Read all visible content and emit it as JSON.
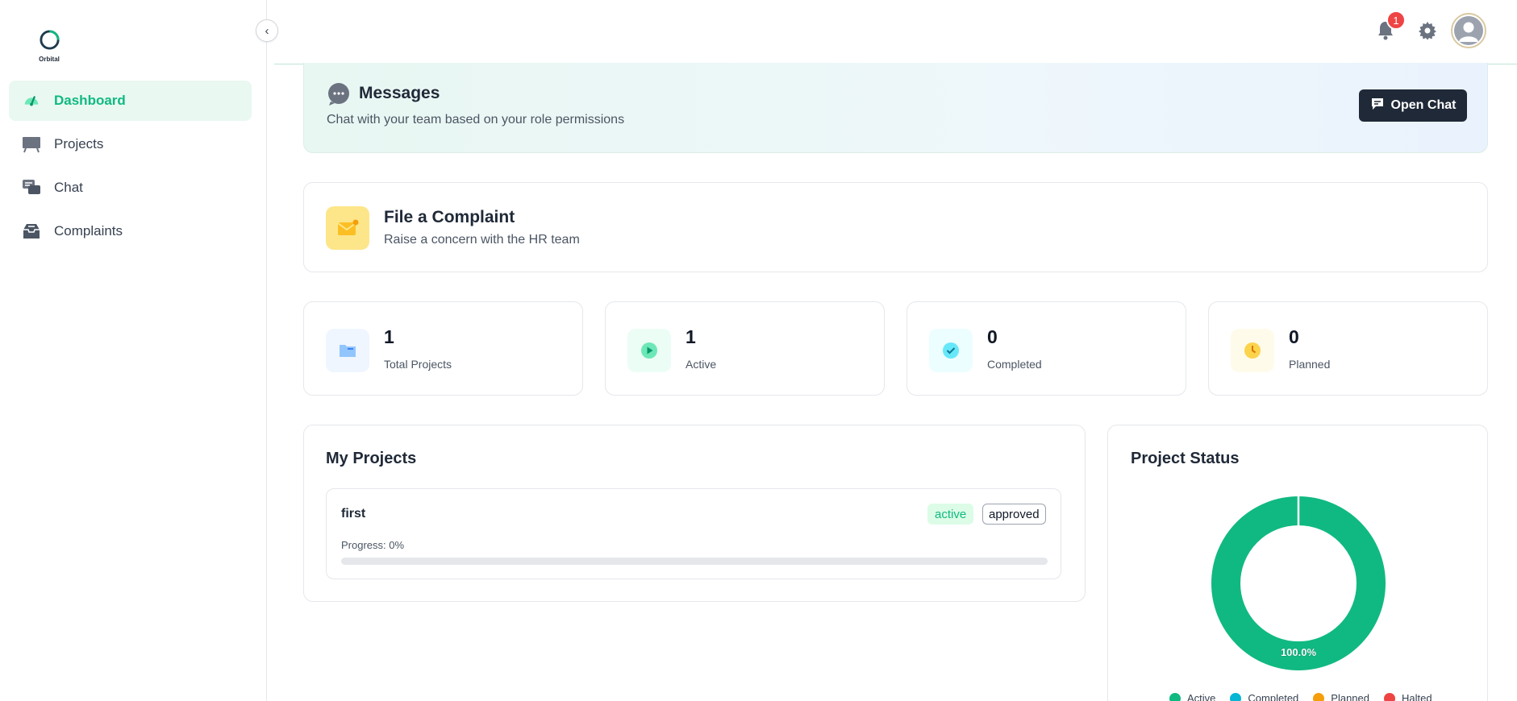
{
  "app": {
    "logo_text": "Orbital"
  },
  "sidebar": {
    "items": [
      {
        "label": "Dashboard",
        "icon": "dashboard-gauge-icon",
        "active": true
      },
      {
        "label": "Projects",
        "icon": "projects-board-icon",
        "active": false
      },
      {
        "label": "Chat",
        "icon": "chat-bubbles-icon",
        "active": false
      },
      {
        "label": "Complaints",
        "icon": "inbox-tray-icon",
        "active": false
      }
    ]
  },
  "header": {
    "notification_count": "1",
    "icons": [
      "bell-icon",
      "gear-icon",
      "user-avatar-icon"
    ]
  },
  "messages": {
    "title": "Messages",
    "subtitle": "Chat with your team based on your role permissions",
    "button_label": "Open Chat"
  },
  "complaint": {
    "title": "File a Complaint",
    "subtitle": "Raise a concern with the HR team"
  },
  "stats": [
    {
      "value": "1",
      "label": "Total Projects",
      "icon": "folder-icon",
      "color": "#3b82f6"
    },
    {
      "value": "1",
      "label": "Active",
      "icon": "play-circle-icon",
      "color": "#10b981"
    },
    {
      "value": "0",
      "label": "Completed",
      "icon": "check-circle-icon",
      "color": "#06b6d4"
    },
    {
      "value": "0",
      "label": "Planned",
      "icon": "clock-icon",
      "color": "#f59e0b"
    }
  ],
  "my_projects": {
    "title": "My Projects",
    "items": [
      {
        "name": "first",
        "status": "active",
        "approval": "approved",
        "progress_label": "Progress: 0%",
        "progress": 0
      }
    ]
  },
  "project_status": {
    "title": "Project Status"
  },
  "chart_data": {
    "type": "pie",
    "categories": [
      "Active",
      "Completed",
      "Planned",
      "Halted"
    ],
    "values": [
      1,
      0,
      0,
      0
    ],
    "colors": [
      "#10b981",
      "#06b6d4",
      "#f59e0b",
      "#ef4444"
    ],
    "data_labels": [
      "100.0%"
    ],
    "legend": "bottom"
  },
  "colors": {
    "accent": "#10b981",
    "dark_button": "#1f2937",
    "notification": "#ef4444"
  }
}
